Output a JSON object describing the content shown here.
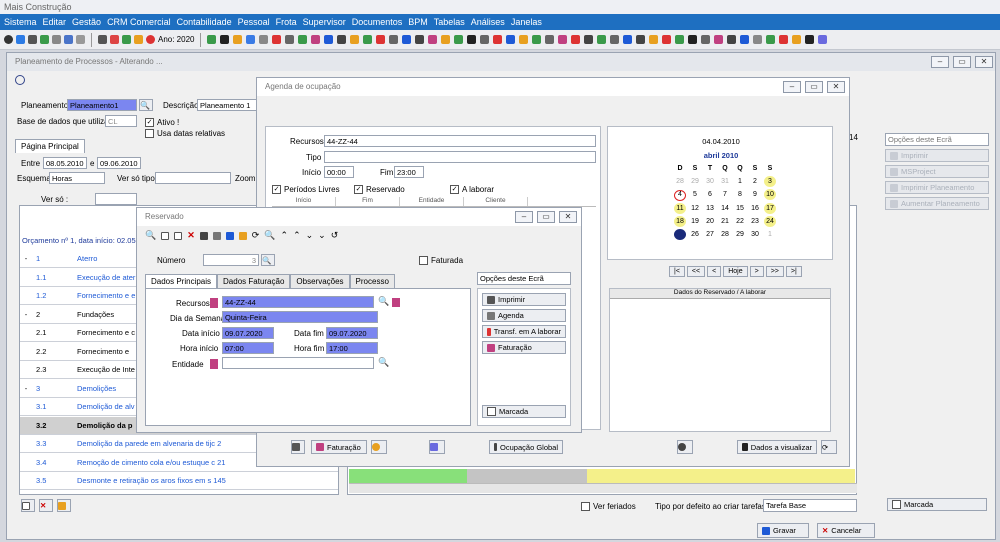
{
  "app": {
    "title": "Mais Construção"
  },
  "menu": [
    "Sistema",
    "Editar",
    "Gestão",
    "CRM Comercial",
    "Contabilidade",
    "Pessoal",
    "Frota",
    "Supervisor",
    "Documentos",
    "BPM",
    "Tabelas",
    "Análises",
    "Janelas"
  ],
  "toolbar": {
    "year_label": "Ano: 2020"
  },
  "planning": {
    "window_title": "Planeamento de Processos - Alterando ...",
    "planeamento_label": "Planeamento",
    "planeamento_value": "Planeamento1",
    "descricao_label": "Descrição",
    "descricao_value": "Planeamento 1",
    "base_label": "Base de dados que utiliza",
    "base_value": "CL",
    "ativo_label": "Ativo !",
    "datas_relativas_label": "Usa datas relativas",
    "tab_label": "Página Principal",
    "entre_label": "Entre",
    "entre_from": "08.05.2010",
    "e_label": "e",
    "entre_to": "09.06.2010",
    "esquema_label": "Esquema",
    "esquema_value": "Horas",
    "ver_so_tipo_label": "Ver só tipo",
    "zoom_label": "Zoom",
    "ver_so_label": "Ver só :",
    "right_num": "14",
    "orcamento_header": "Orçamento nº 1, data início: 02.05.2",
    "rows": [
      {
        "c1": "-",
        "c2": "1",
        "c3": "Aterro",
        "blue": true
      },
      {
        "c1": "",
        "c2": "1.1",
        "c3": "Execução de ater",
        "blue": true
      },
      {
        "c1": "",
        "c2": "1.2",
        "c3": "Fornecimento e e",
        "blue": true
      },
      {
        "c1": "-",
        "c2": "2",
        "c3": "Fundações",
        "blue": false
      },
      {
        "c1": "",
        "c2": "2.1",
        "c3": "Fornecimento e c",
        "blue": false
      },
      {
        "c1": "",
        "c2": "2.2",
        "c3": "Fornecimento  e",
        "blue": false
      },
      {
        "c1": "",
        "c2": "2.3",
        "c3": "Execução de Inte",
        "blue": false
      },
      {
        "c1": "-",
        "c2": "3",
        "c3": "Demolições",
        "blue": true
      },
      {
        "c1": "",
        "c2": "3.1",
        "c3": "Demolição de alv",
        "blue": true
      },
      {
        "c1": "",
        "c2": "3.2",
        "c3": "Demolição da p",
        "blue": false,
        "bold": true
      },
      {
        "c1": "",
        "c2": "3.3",
        "c3": "Demolição da parede em alvenaria de tijc 2",
        "blue": true
      },
      {
        "c1": "",
        "c2": "3.4",
        "c3": "Remoção de cimento cola e/ou estuque c 21",
        "blue": true
      },
      {
        "c1": "",
        "c2": "3.5",
        "c3": "Desmonte e retiração os aros fixos em s 145",
        "blue": true
      }
    ],
    "ver_feriados_label": "Ver feriados",
    "tipo_defeito_label": "Tipo por defeito ao criar tarefas",
    "tipo_defeito_value": "Tarefa Base",
    "gravar_label": "Gravar",
    "cancelar_label": "Cancelar",
    "opcoes_label": "Opções deste Ecrã",
    "side_buttons": [
      "Imprimir",
      "MSProject",
      "Imprimir Planeamento",
      "Aumentar Planeamento"
    ],
    "marcada_label": "Marcada"
  },
  "agenda": {
    "window_title": "Agenda de ocupação",
    "recursos_label": "Recursos",
    "recursos_value": "44-ZZ-44",
    "tipo_label": "Tipo",
    "inicio_label": "Início",
    "inicio_value": "00:00",
    "fim_label": "Fim",
    "fim_value": "23:00",
    "periodos_label": "Períodos Livres",
    "reservado_label": "Reservado",
    "a_laborar_label": "A laborar",
    "grid_headers": [
      "Início",
      "Fim",
      "Entidade",
      "Cliente"
    ],
    "cal_date": "04.04.2010",
    "cal_month": "abril 2010",
    "cal_days": [
      "D",
      "S",
      "T",
      "Q",
      "Q",
      "S",
      "S"
    ],
    "cal_weeks": [
      [
        "28",
        "29",
        "30",
        "31",
        "1",
        "2",
        "3"
      ],
      [
        "4",
        "5",
        "6",
        "7",
        "8",
        "9",
        "10"
      ],
      [
        "11",
        "12",
        "13",
        "14",
        "15",
        "16",
        "17"
      ],
      [
        "18",
        "19",
        "20",
        "21",
        "22",
        "23",
        "24"
      ],
      [
        "25",
        "26",
        "27",
        "28",
        "29",
        "30",
        "1"
      ]
    ],
    "cal_nav": [
      "|<",
      "<<",
      "<",
      "Hoje",
      ">",
      ">>",
      ">|"
    ],
    "dados_header": "Dados do Reservado / A laborar",
    "faturacao_label": "Faturação",
    "ocupacao_label": "Ocupação Global",
    "dados_visualizar_label": "Dados a visualizar"
  },
  "reservado": {
    "window_title": "Reservado",
    "numero_label": "Número",
    "numero_value": "3",
    "faturada_label": "Faturada",
    "tabs": [
      "Dados Principais",
      "Dados Faturação",
      "Observações",
      "Processo"
    ],
    "recursos_label": "Recursos",
    "recursos_value": "44-ZZ-44",
    "dia_label": "Dia da Semana",
    "dia_value": "Quinta-Feira",
    "data_inicio_label": "Data início",
    "data_inicio_value": "09.07.2020",
    "data_fim_label": "Data fim",
    "data_fim_value": "09.07.2020",
    "hora_inicio_label": "Hora início",
    "hora_inicio_value": "07:00",
    "hora_fim_label": "Hora fim",
    "hora_fim_value": "17:00",
    "entidade_label": "Entidade",
    "opcoes_label": "Opções deste Ecrã",
    "actions": [
      "Imprimir",
      "Agenda",
      "Transf. em A laborar",
      "Faturação"
    ],
    "marcada_label": "Marcada"
  }
}
